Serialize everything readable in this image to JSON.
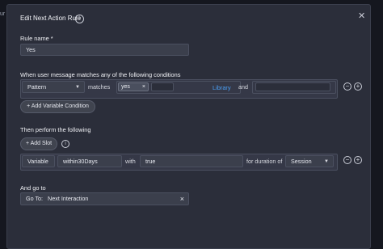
{
  "background": {
    "left_text": "ur"
  },
  "dialog": {
    "title": "Edit Next Action Rule",
    "close_icon": "close-icon"
  },
  "rule_name": {
    "label": "Rule name *",
    "value": "Yes"
  },
  "conditions": {
    "label": "When user message matches any of the following conditions",
    "type_value": "Pattern",
    "matches_label": "matches",
    "chip_value": "yes",
    "chip_remove": "×",
    "library_label": "Library",
    "and_label": "and",
    "add_variable_button": "+ Add Variable Condition",
    "remove_icon": "−",
    "add_icon": "+"
  },
  "actions": {
    "label": "Then perform the following",
    "add_slot_button": "+ Add Slot",
    "slot_type": "Variable",
    "slot_name": "within30Days",
    "with_label": "with",
    "slot_value": "true",
    "duration_label": "for duration of",
    "duration_value": "Session",
    "remove_icon": "−",
    "add_icon": "+"
  },
  "goto": {
    "label": "And go to",
    "prefix": "Go To:",
    "value": "Next Interaction",
    "clear_icon": "×"
  },
  "colors": {
    "accent_link": "#4a9ff5",
    "dialog_bg": "#2b2e3a",
    "field_bg": "#3b3f4c"
  }
}
